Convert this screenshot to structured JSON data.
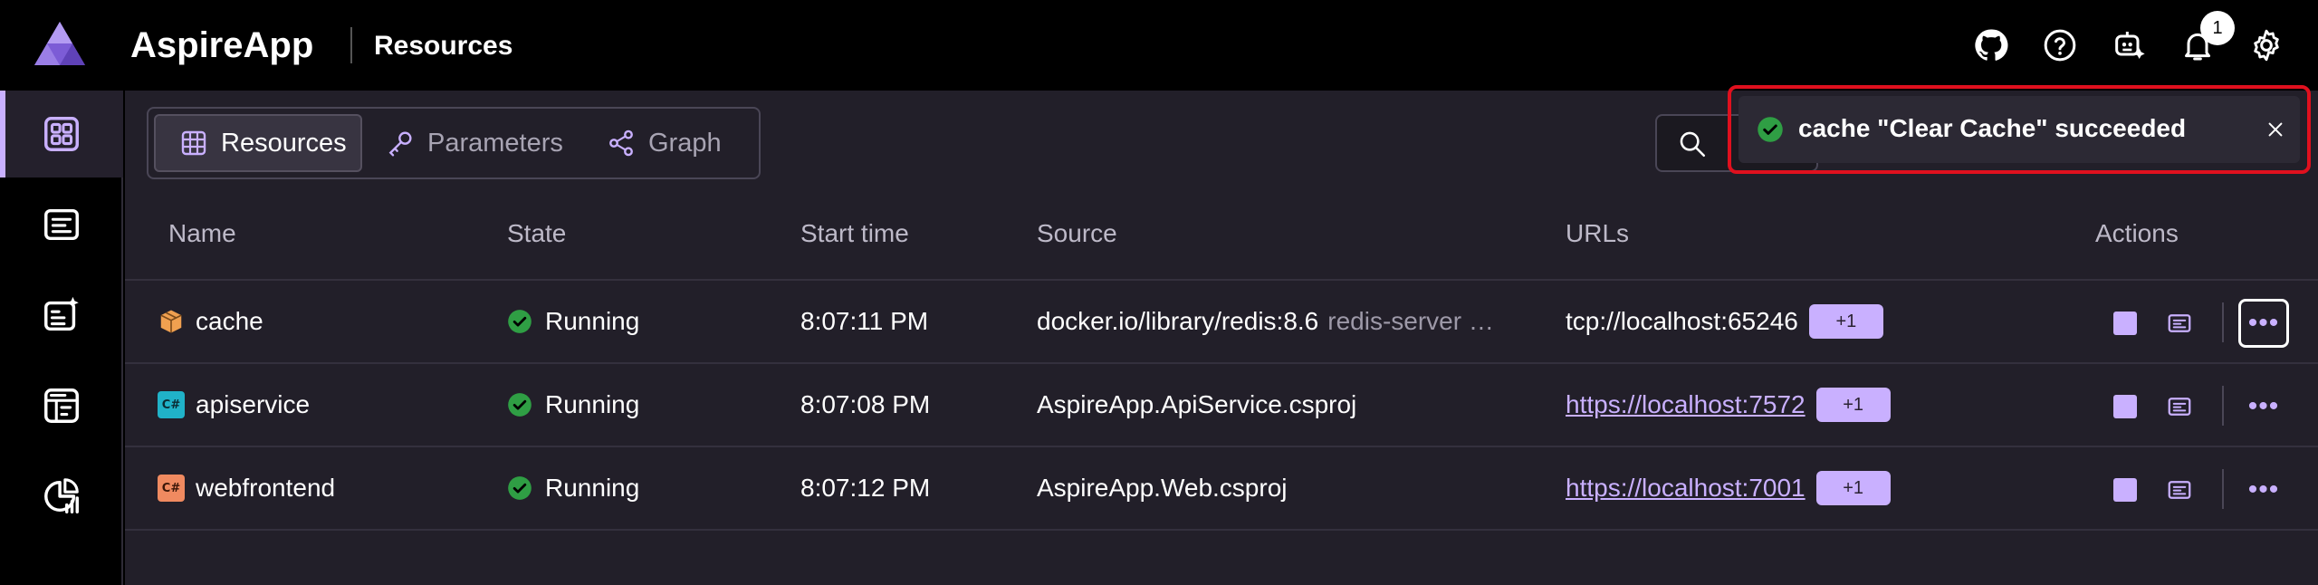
{
  "app": {
    "title": "AspireApp",
    "page": "Resources"
  },
  "header_icons": [
    "github-icon",
    "help-icon",
    "copilot-icon",
    "bell-icon",
    "gear-icon"
  ],
  "notifications": {
    "count": "1"
  },
  "rail_items": [
    "resources-icon",
    "console-logs-icon",
    "structured-logs-icon",
    "traces-icon",
    "metrics-icon"
  ],
  "tabs": [
    {
      "label": "Resources",
      "icon": "grid-icon"
    },
    {
      "label": "Parameters",
      "icon": "key-icon"
    },
    {
      "label": "Graph",
      "icon": "share-icon"
    }
  ],
  "columns": {
    "name": "Name",
    "state": "State",
    "start_time": "Start time",
    "source": "Source",
    "urls": "URLs",
    "actions": "Actions"
  },
  "rows": [
    {
      "name": "cache",
      "type_icon": "container-icon",
      "state": "Running",
      "start_time": "8:07:11 PM",
      "source": "docker.io/library/redis:8.6",
      "source_args": "redis-server …",
      "url": "tcp://localhost:65246",
      "url_is_link": false,
      "extra_urls": "+1"
    },
    {
      "name": "apiservice",
      "type_icon": "csharp-project-icon",
      "state": "Running",
      "start_time": "8:07:08 PM",
      "source": "AspireApp.ApiService.csproj",
      "source_args": "",
      "url": "https://localhost:7572",
      "url_is_link": true,
      "extra_urls": "+1"
    },
    {
      "name": "webfrontend",
      "type_icon": "csharp-project-icon",
      "state": "Running",
      "start_time": "8:07:12 PM",
      "source": "AspireApp.Web.csproj",
      "source_args": "",
      "url": "https://localhost:7001",
      "url_is_link": true,
      "extra_urls": "+1"
    }
  ],
  "toast": {
    "message": "cache \"Clear Cache\" succeeded",
    "status": "success"
  },
  "colors": {
    "accent": "#c9b0ff",
    "success": "#2f9e44",
    "background": "#000000",
    "panel": "#221f29",
    "highlight_outline": "#e0101e"
  }
}
